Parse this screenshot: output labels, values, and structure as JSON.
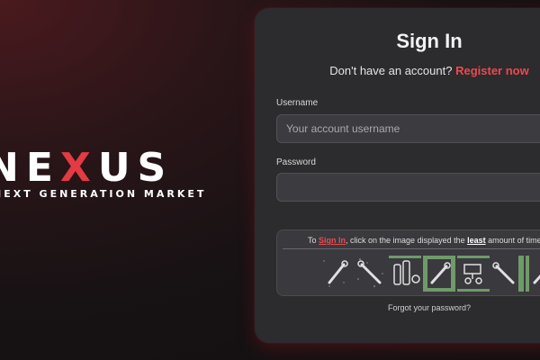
{
  "logo": {
    "word_pre": "N",
    "word_x": "X",
    "word_post": "US",
    "tagline": "NEXT GENERATION MARKET"
  },
  "signin": {
    "title": "Sign In",
    "no_account_text": "Don't have an account?",
    "register_link": "Register now",
    "username_label": "Username",
    "username_placeholder": "Your account username",
    "password_label": "Password",
    "password_placeholder": "",
    "forgot_link": "Forgot your password?"
  },
  "captcha": {
    "prefix": "To",
    "signin_word": "Sign In",
    "middle": ", click on the image displayed the",
    "emphasis": "least",
    "suffix": "amount of time",
    "tiles": [
      "wrench-icon",
      "wrench-icon",
      "bottles-icon",
      "wrench-icon",
      "machine-icon",
      "wrench-icon",
      "wrench-icon"
    ]
  },
  "colors": {
    "accent": "#ea4a4f",
    "card_bg": "#2c2b2e",
    "input_bg": "#3c3b3f",
    "captcha_green": "#6f9a6a"
  }
}
